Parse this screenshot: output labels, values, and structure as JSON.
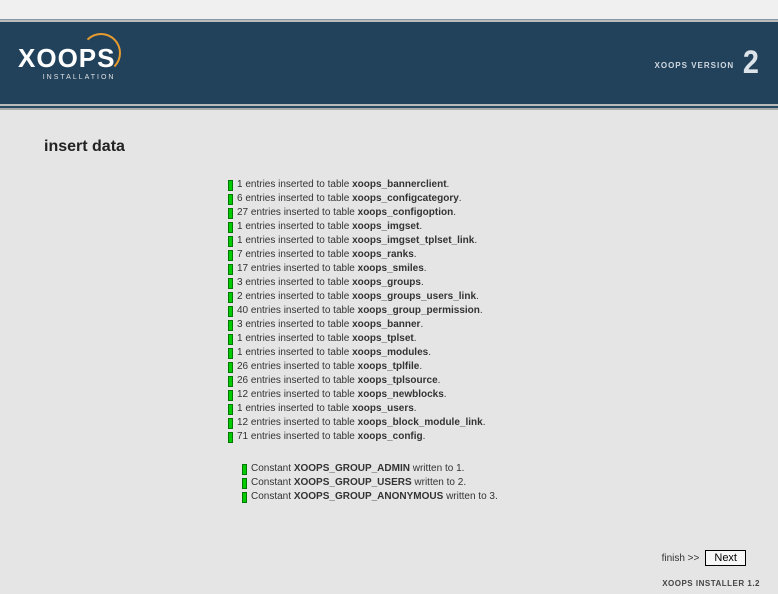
{
  "header": {
    "logo_text": "XOOPS",
    "logo_sub": "INSTALLATION",
    "version_label": "XOOPS VERSION",
    "version_num": "2"
  },
  "page": {
    "title": "insert data"
  },
  "log1": [
    {
      "prefix": "1 entries inserted to table ",
      "strong": "xoops_bannerclient",
      "suffix": "."
    },
    {
      "prefix": "6 entries inserted to table ",
      "strong": "xoops_configcategory",
      "suffix": "."
    },
    {
      "prefix": "27 entries inserted to table ",
      "strong": "xoops_configoption",
      "suffix": "."
    },
    {
      "prefix": "1 entries inserted to table ",
      "strong": "xoops_imgset",
      "suffix": "."
    },
    {
      "prefix": "1 entries inserted to table ",
      "strong": "xoops_imgset_tplset_link",
      "suffix": "."
    },
    {
      "prefix": "7 entries inserted to table ",
      "strong": "xoops_ranks",
      "suffix": "."
    },
    {
      "prefix": "17 entries inserted to table ",
      "strong": "xoops_smiles",
      "suffix": "."
    },
    {
      "prefix": "3 entries inserted to table ",
      "strong": "xoops_groups",
      "suffix": "."
    },
    {
      "prefix": "2 entries inserted to table ",
      "strong": "xoops_groups_users_link",
      "suffix": "."
    },
    {
      "prefix": "40 entries inserted to table ",
      "strong": "xoops_group_permission",
      "suffix": "."
    },
    {
      "prefix": "3 entries inserted to table ",
      "strong": "xoops_banner",
      "suffix": "."
    },
    {
      "prefix": "1 entries inserted to table ",
      "strong": "xoops_tplset",
      "suffix": "."
    },
    {
      "prefix": "1 entries inserted to table ",
      "strong": "xoops_modules",
      "suffix": "."
    },
    {
      "prefix": "26 entries inserted to table ",
      "strong": "xoops_tplfile",
      "suffix": "."
    },
    {
      "prefix": "26 entries inserted to table ",
      "strong": "xoops_tplsource",
      "suffix": "."
    },
    {
      "prefix": "12 entries inserted to table ",
      "strong": "xoops_newblocks",
      "suffix": "."
    },
    {
      "prefix": "1 entries inserted to table ",
      "strong": "xoops_users",
      "suffix": "."
    },
    {
      "prefix": "12 entries inserted to table ",
      "strong": "xoops_block_module_link",
      "suffix": "."
    },
    {
      "prefix": "71 entries inserted to table ",
      "strong": "xoops_config",
      "suffix": "."
    }
  ],
  "log2": [
    {
      "prefix": "Constant ",
      "strong": "XOOPS_GROUP_ADMIN",
      "suffix": " written to 1."
    },
    {
      "prefix": "Constant ",
      "strong": "XOOPS_GROUP_USERS",
      "suffix": " written to 2."
    },
    {
      "prefix": "Constant ",
      "strong": "XOOPS_GROUP_ANONYMOUS",
      "suffix": " written to 3."
    }
  ],
  "footer": {
    "finish_label": "finish >>",
    "next_label": "Next",
    "installer_label": "XOOPS INSTALLER 1.2"
  }
}
